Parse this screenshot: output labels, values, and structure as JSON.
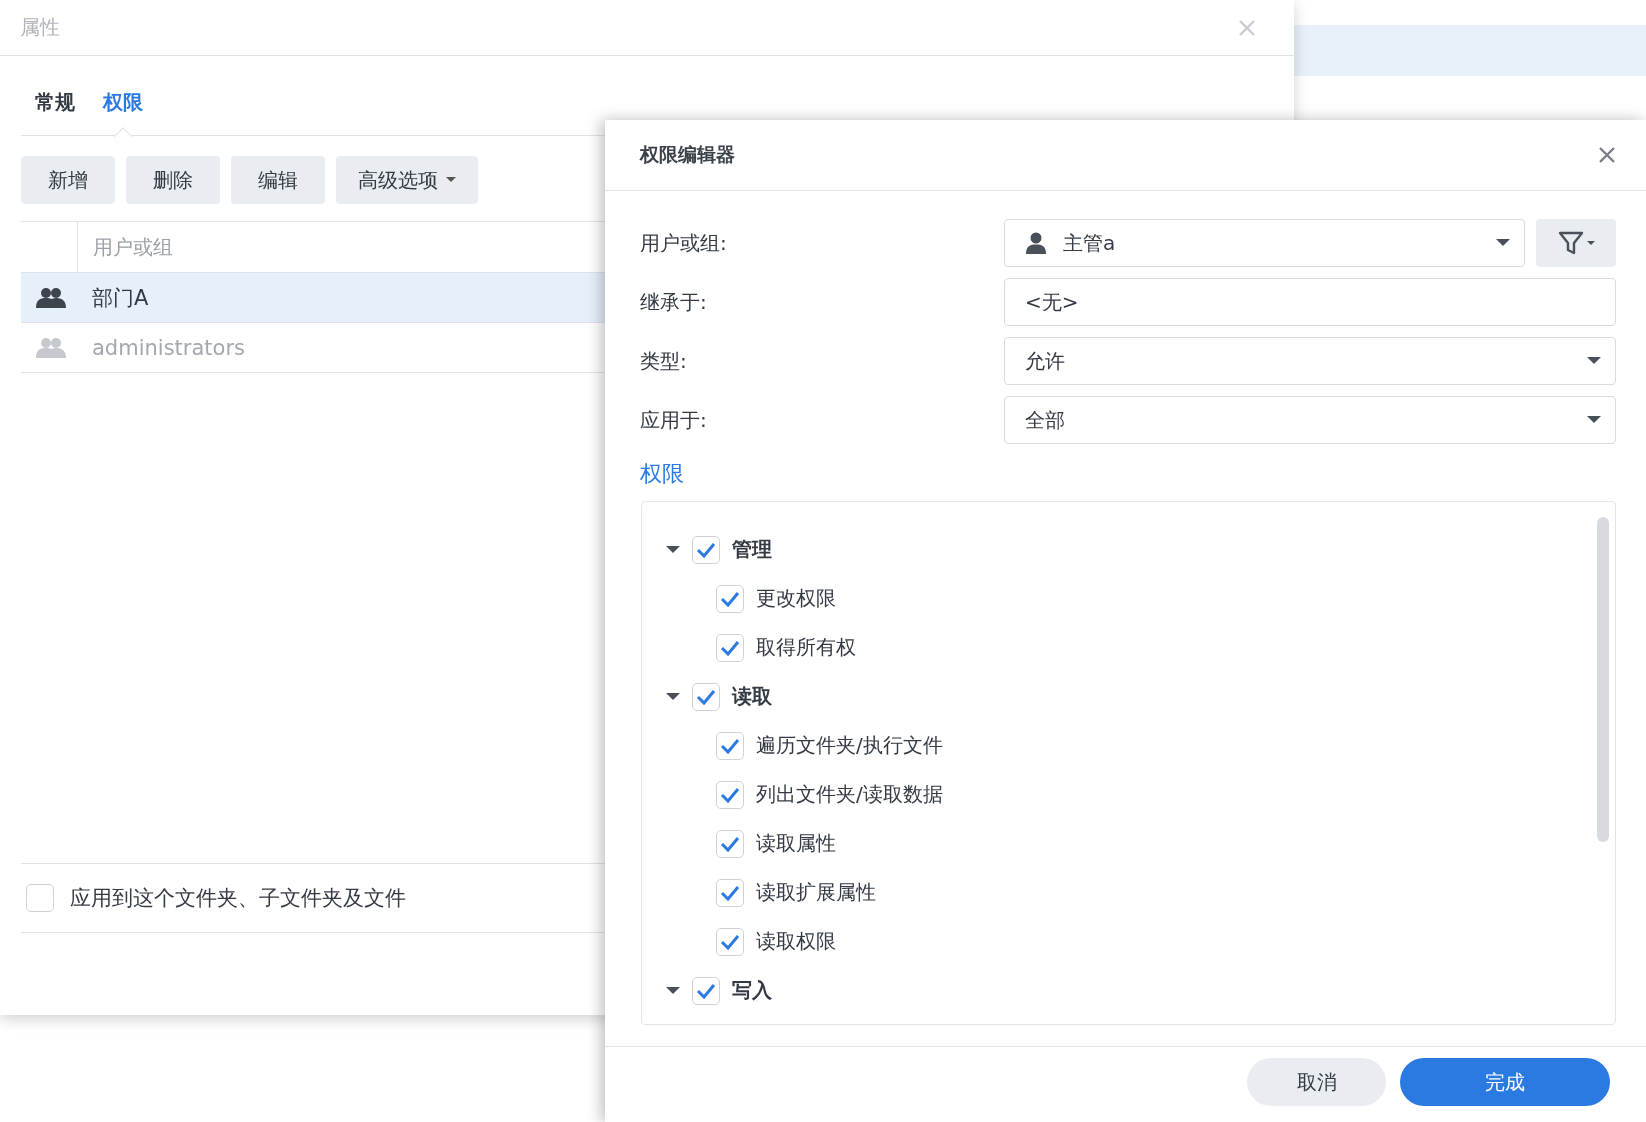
{
  "background_window": {
    "title": "属性",
    "tabs": [
      {
        "label": "常规",
        "selected": false
      },
      {
        "label": "权限",
        "selected": true
      }
    ],
    "toolbar": [
      {
        "label": "新增",
        "kind": "button"
      },
      {
        "label": "删除",
        "kind": "button"
      },
      {
        "label": "编辑",
        "kind": "button"
      },
      {
        "label": "高级选项",
        "kind": "dropdown"
      }
    ],
    "table": {
      "columns": [
        "用户或组"
      ],
      "rows": [
        {
          "name": "部门A",
          "selected": true,
          "disabled": false
        },
        {
          "name": "administrators",
          "selected": false,
          "disabled": true
        }
      ]
    },
    "apply_option": {
      "label": "应用到这个文件夹、子文件夹及文件",
      "checked": false
    }
  },
  "editor": {
    "title": "权限编辑器",
    "fields": [
      {
        "label": "用户或组:",
        "value": "主管a",
        "kind": "user-select"
      },
      {
        "label": "继承于:",
        "value": "<无>",
        "kind": "text"
      },
      {
        "label": "类型:",
        "value": "允许",
        "kind": "select"
      },
      {
        "label": "应用于:",
        "value": "全部",
        "kind": "select"
      }
    ],
    "section_title": "权限",
    "permissions": [
      {
        "label": "管理",
        "checked": true,
        "expanded": true,
        "children": [
          {
            "label": "更改权限",
            "checked": true
          },
          {
            "label": "取得所有权",
            "checked": true
          }
        ]
      },
      {
        "label": "读取",
        "checked": true,
        "expanded": true,
        "children": [
          {
            "label": "遍历文件夹/执行文件",
            "checked": true
          },
          {
            "label": "列出文件夹/读取数据",
            "checked": true
          },
          {
            "label": "读取属性",
            "checked": true
          },
          {
            "label": "读取扩展属性",
            "checked": true
          },
          {
            "label": "读取权限",
            "checked": true
          }
        ]
      },
      {
        "label": "写入",
        "checked": true,
        "expanded": true
      }
    ],
    "buttons": [
      {
        "label": "取消",
        "kind": "secondary"
      },
      {
        "label": "完成",
        "kind": "primary"
      }
    ]
  }
}
